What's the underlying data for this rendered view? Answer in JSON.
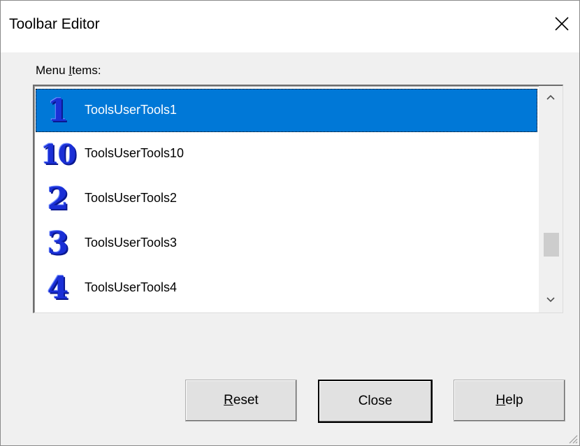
{
  "window": {
    "title": "Toolbar Editor"
  },
  "menu_items": {
    "label_prefix": "Menu ",
    "label_accel": "I",
    "label_suffix": "tems:",
    "items": [
      {
        "icon": "1",
        "label": "ToolsUserTools1",
        "selected": true
      },
      {
        "icon": "10",
        "label": "ToolsUserTools10",
        "selected": false
      },
      {
        "icon": "2",
        "label": "ToolsUserTools2",
        "selected": false
      },
      {
        "icon": "3",
        "label": "ToolsUserTools3",
        "selected": false
      },
      {
        "icon": "4",
        "label": "ToolsUserTools4",
        "selected": false
      }
    ]
  },
  "buttons": {
    "reset_accel": "R",
    "reset_rest": "eset",
    "close": "Close",
    "help_accel": "H",
    "help_rest": "elp"
  },
  "colors": {
    "selection": "#0078d7",
    "icon_blue": "#1a2fd6"
  },
  "icons": {
    "close": "close-icon",
    "scroll_up": "chevron-up-icon",
    "scroll_down": "chevron-down-icon",
    "resize": "resize-grip-icon"
  }
}
